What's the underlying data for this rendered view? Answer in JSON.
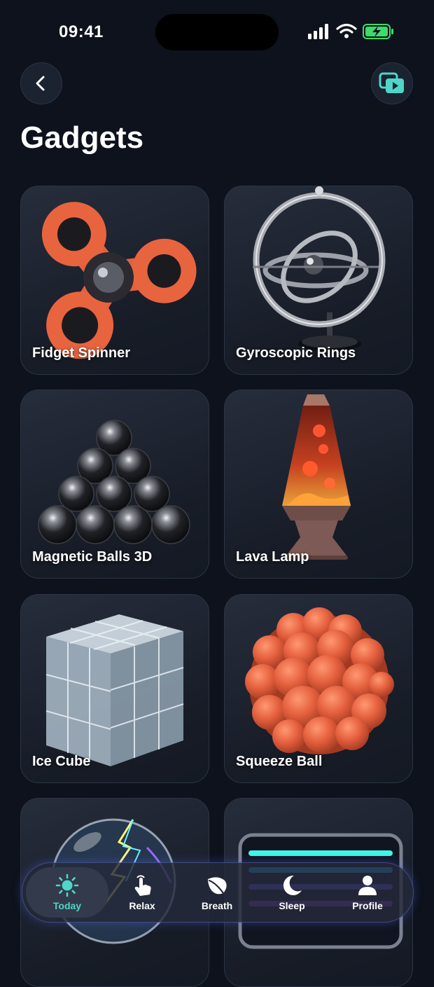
{
  "status": {
    "time": "09:41"
  },
  "header": {
    "title": "Gadgets"
  },
  "gadgets": [
    {
      "label": "Fidget Spinner"
    },
    {
      "label": "Gyroscopic Rings"
    },
    {
      "label": "Magnetic Balls 3D"
    },
    {
      "label": "Lava Lamp"
    },
    {
      "label": "Ice Cube"
    },
    {
      "label": "Squeeze Ball"
    }
  ],
  "tabs": [
    {
      "label": "Today",
      "icon": "sun-icon",
      "active": true
    },
    {
      "label": "Relax",
      "icon": "hand-tap-icon"
    },
    {
      "label": "Breath",
      "icon": "leaf-icon"
    },
    {
      "label": "Sleep",
      "icon": "moon-icon"
    },
    {
      "label": "Profile",
      "icon": "person-icon"
    }
  ],
  "colors": {
    "accent": "#4fd6c8",
    "background": "#0d121c",
    "card": "#1e2430"
  }
}
